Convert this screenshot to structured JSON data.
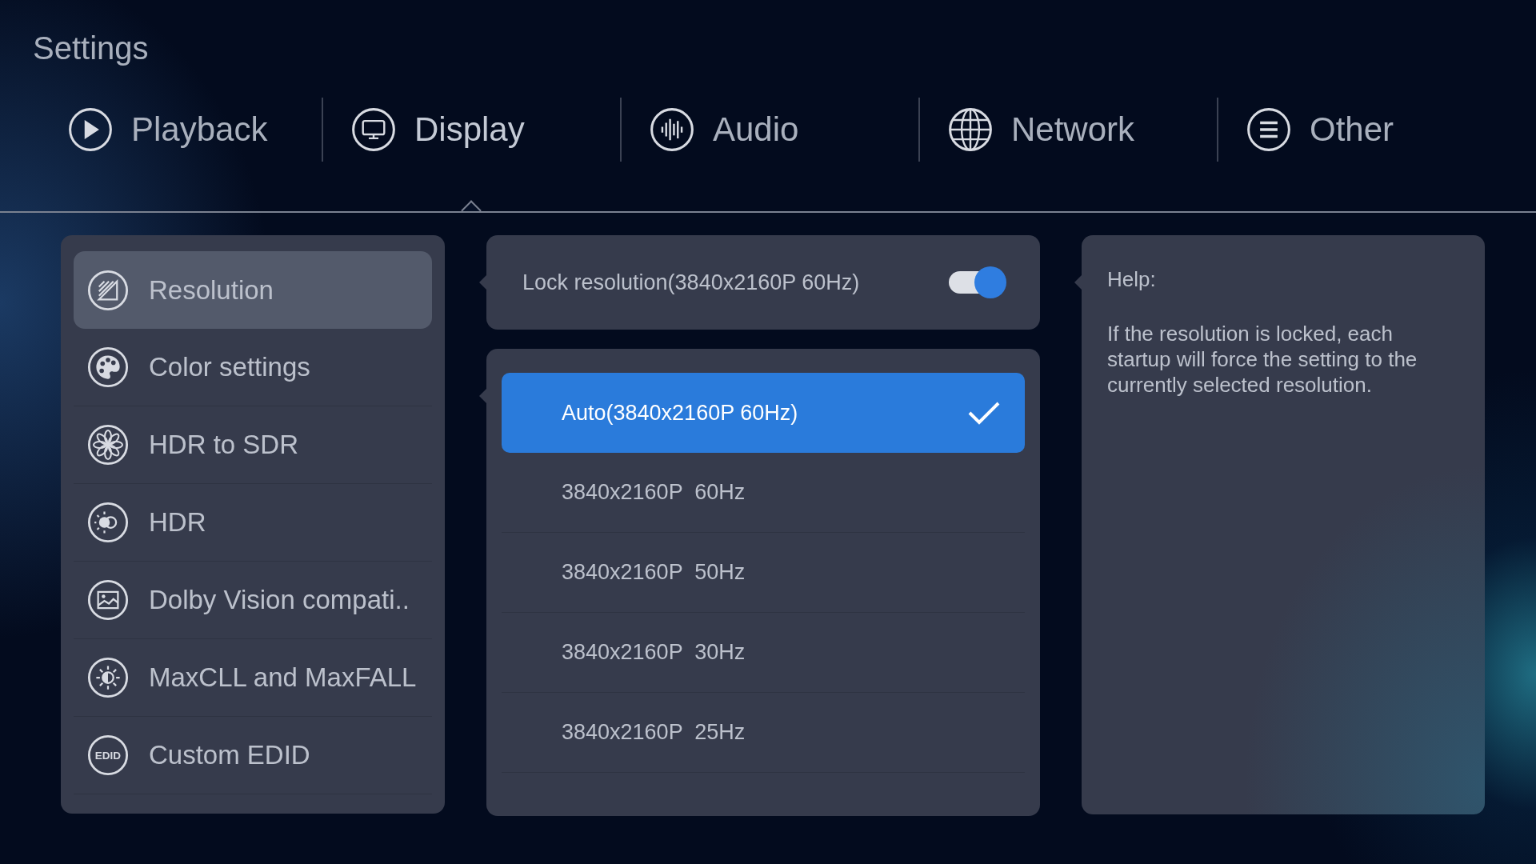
{
  "title": "Settings",
  "tabs": [
    {
      "label": "Playback",
      "kind": "play",
      "selected": false
    },
    {
      "label": "Display",
      "kind": "monitor",
      "selected": true
    },
    {
      "label": "Audio",
      "kind": "wave",
      "selected": false
    },
    {
      "label": "Network",
      "kind": "globe",
      "selected": false
    },
    {
      "label": "Other",
      "kind": "list",
      "selected": false
    }
  ],
  "sidebar": {
    "items": [
      {
        "label": "Resolution",
        "kind": "resolution",
        "selected": true
      },
      {
        "label": "Color settings",
        "kind": "palette",
        "selected": false
      },
      {
        "label": "HDR to SDR",
        "kind": "flower",
        "selected": false
      },
      {
        "label": "HDR",
        "kind": "hdr",
        "selected": false
      },
      {
        "label": "Dolby Vision compati..",
        "kind": "image",
        "selected": false
      },
      {
        "label": "MaxCLL and MaxFALL",
        "kind": "contrast",
        "selected": false
      },
      {
        "label": "Custom EDID",
        "kind": "edid",
        "icon_text": "EDID",
        "selected": false
      }
    ]
  },
  "lock": {
    "label": "Lock resolution(3840x2160P 60Hz)",
    "on": true
  },
  "options": [
    {
      "label": "Auto(3840x2160P 60Hz)",
      "selected": true
    },
    {
      "label": "3840x2160P  60Hz",
      "selected": false
    },
    {
      "label": "3840x2160P  50Hz",
      "selected": false
    },
    {
      "label": "3840x2160P  30Hz",
      "selected": false
    },
    {
      "label": "3840x2160P  25Hz",
      "selected": false
    }
  ],
  "help": {
    "title": "Help:",
    "text": "If the resolution is locked, each startup will force the setting to the currently selected resolution."
  }
}
